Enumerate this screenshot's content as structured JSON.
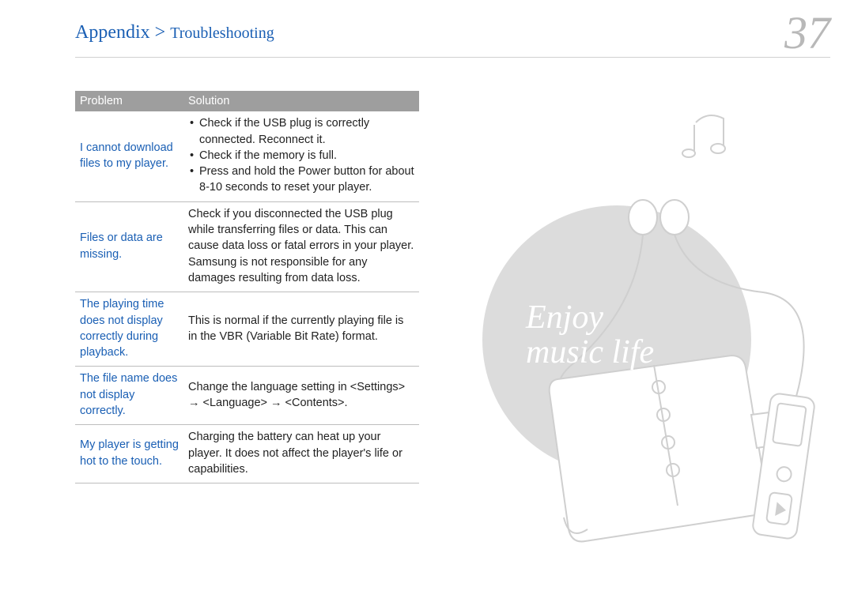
{
  "breadcrumb": {
    "main": "Appendix",
    "separator": ">",
    "sub": "Troubleshooting"
  },
  "page_number": "37",
  "table": {
    "headers": {
      "problem": "Problem",
      "solution": "Solution"
    },
    "rows": [
      {
        "problem": "I cannot download files to my player.",
        "solution_bullets": [
          "Check if the USB plug is correctly connected. Reconnect it.",
          "Check if the memory is full.",
          "Press and hold the Power button for about 8-10 seconds to reset your player."
        ]
      },
      {
        "problem": "Files or data are missing.",
        "solution": "Check if you disconnected the USB plug while transferring files or data. This can cause data loss or fatal errors in your player. Samsung is not responsible for any damages resulting from data loss."
      },
      {
        "problem": "The playing time does not display correctly during playback.",
        "solution": "This is normal if the currently playing file is in the VBR (Variable Bit Rate) format."
      },
      {
        "problem": "The file name does not display correctly.",
        "solution": "Change the language setting in <Settings> → <Language> → <Contents>."
      },
      {
        "problem": "My player is getting hot to the touch.",
        "solution": "Charging the battery can heat up your player. It does not affect the player's life or capabilities."
      }
    ]
  },
  "illustration": {
    "line1": "Enjoy",
    "line2": "music life"
  }
}
